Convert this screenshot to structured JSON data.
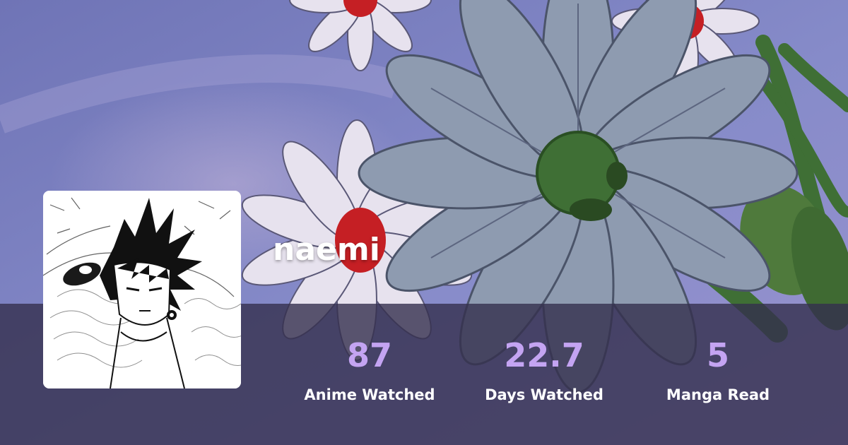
{
  "profile": {
    "username": "naemi",
    "avatar_icon": "character-portrait-icon",
    "banner_icon": "daisy-flowers-banner-icon"
  },
  "stats": [
    {
      "value": "87",
      "label": "Anime Watched"
    },
    {
      "value": "22.7",
      "label": "Days Watched"
    },
    {
      "value": "5",
      "label": "Manga Read"
    }
  ],
  "colors": {
    "stat_value": "#c4a4f2",
    "stat_label": "#ffffff",
    "username": "#ffffff",
    "stats_bar": "#34304e"
  }
}
